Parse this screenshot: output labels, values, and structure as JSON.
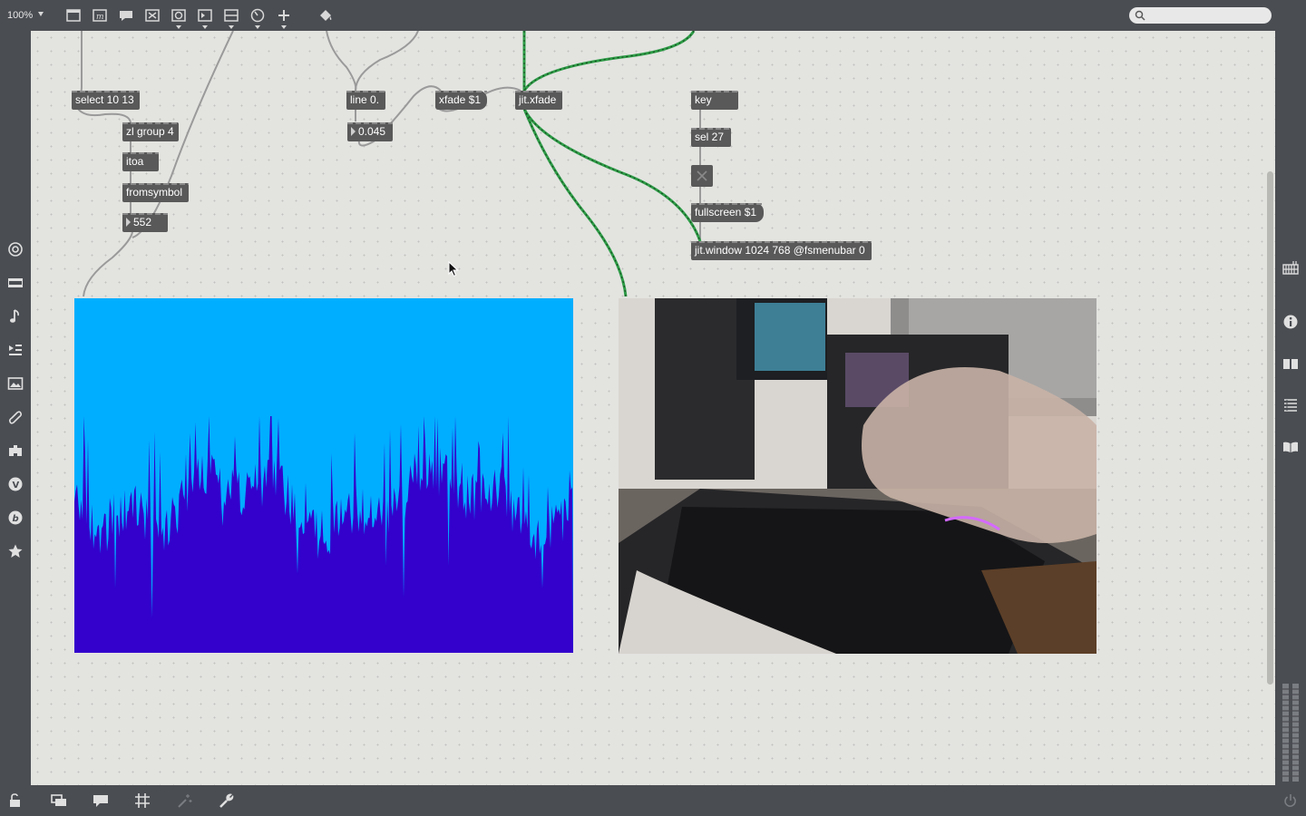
{
  "toolbar": {
    "zoom": "100%",
    "search_placeholder": ""
  },
  "objects": {
    "select": "select 10 13",
    "zl_group": "zl group 4",
    "itoa": "itoa",
    "fromsymbol": "fromsymbol",
    "number_552": "552",
    "line": "line 0.",
    "number_0045": "0.045",
    "xfade_msg": "xfade $1",
    "jit_xfade": "jit.xfade",
    "key": "key",
    "sel27": "sel 27",
    "fullscreen_msg": "fullscreen $1",
    "jit_window": "jit.window 1024 768 @fsmenubar 0"
  },
  "colors": {
    "canvas": "#e3e3e0",
    "object_bg": "#595959",
    "chrome": "#4a4d52",
    "waveform_bg": "#00aeff",
    "waveform_fill": "#3300cc",
    "matrix_cord": "#2e9e47"
  },
  "icons": {
    "left_sidebar": [
      "target-icon",
      "film-icon",
      "music-note-icon",
      "playlist-icon",
      "image-icon",
      "paperclip-icon",
      "snippet-icon",
      "vizzie-icon",
      "beap-icon",
      "star-icon"
    ],
    "right_sidebar": [
      "grid-icon",
      "info-icon",
      "book-icon",
      "list-icon",
      "reference-icon"
    ],
    "bottom_bar": [
      "lock-icon",
      "presentation-icon",
      "comment-icon",
      "grid-icon",
      "magic-icon",
      "wrench-icon",
      "power-icon"
    ]
  }
}
